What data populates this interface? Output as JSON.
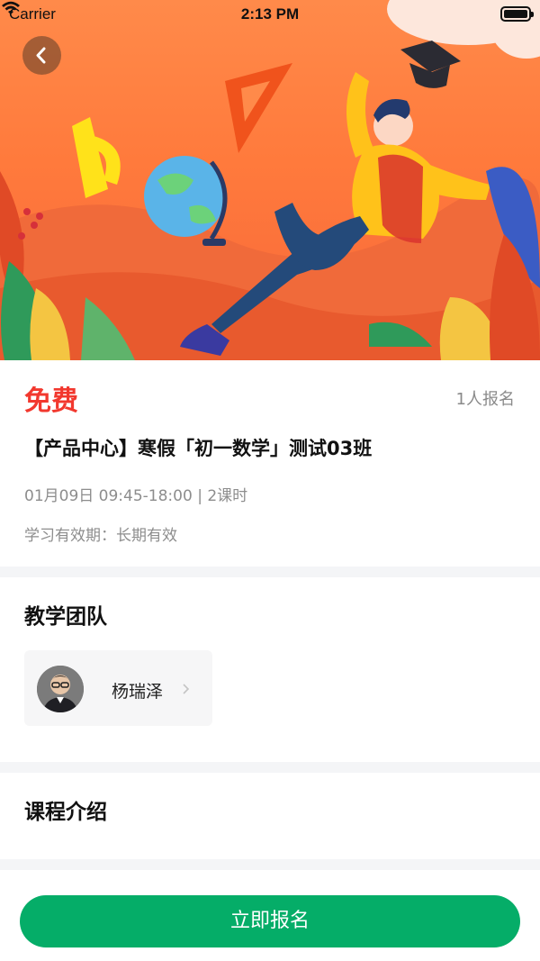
{
  "status_bar": {
    "carrier": "Carrier",
    "time": "2:13 PM"
  },
  "course": {
    "price": "免费",
    "enroll_count": "1人报名",
    "title": "【产品中心】寒假「初一数学」测试03班",
    "time": "01月09日 09:45-18:00 | 2课时",
    "validity": "学习有效期：长期有效"
  },
  "team": {
    "title": "教学团队",
    "teachers": [
      {
        "name": "杨瑞泽"
      }
    ]
  },
  "intro": {
    "title": "课程介绍"
  },
  "bottom": {
    "signup_label": "立即报名"
  },
  "colors": {
    "price": "#f2382e",
    "primary_button": "#05ad68",
    "hero_bg": "#ff7a3c"
  },
  "icons": {
    "back": "chevron-left-icon",
    "wifi": "wifi-icon",
    "battery": "battery-icon",
    "teacher_arrow": "chevron-right-icon"
  }
}
